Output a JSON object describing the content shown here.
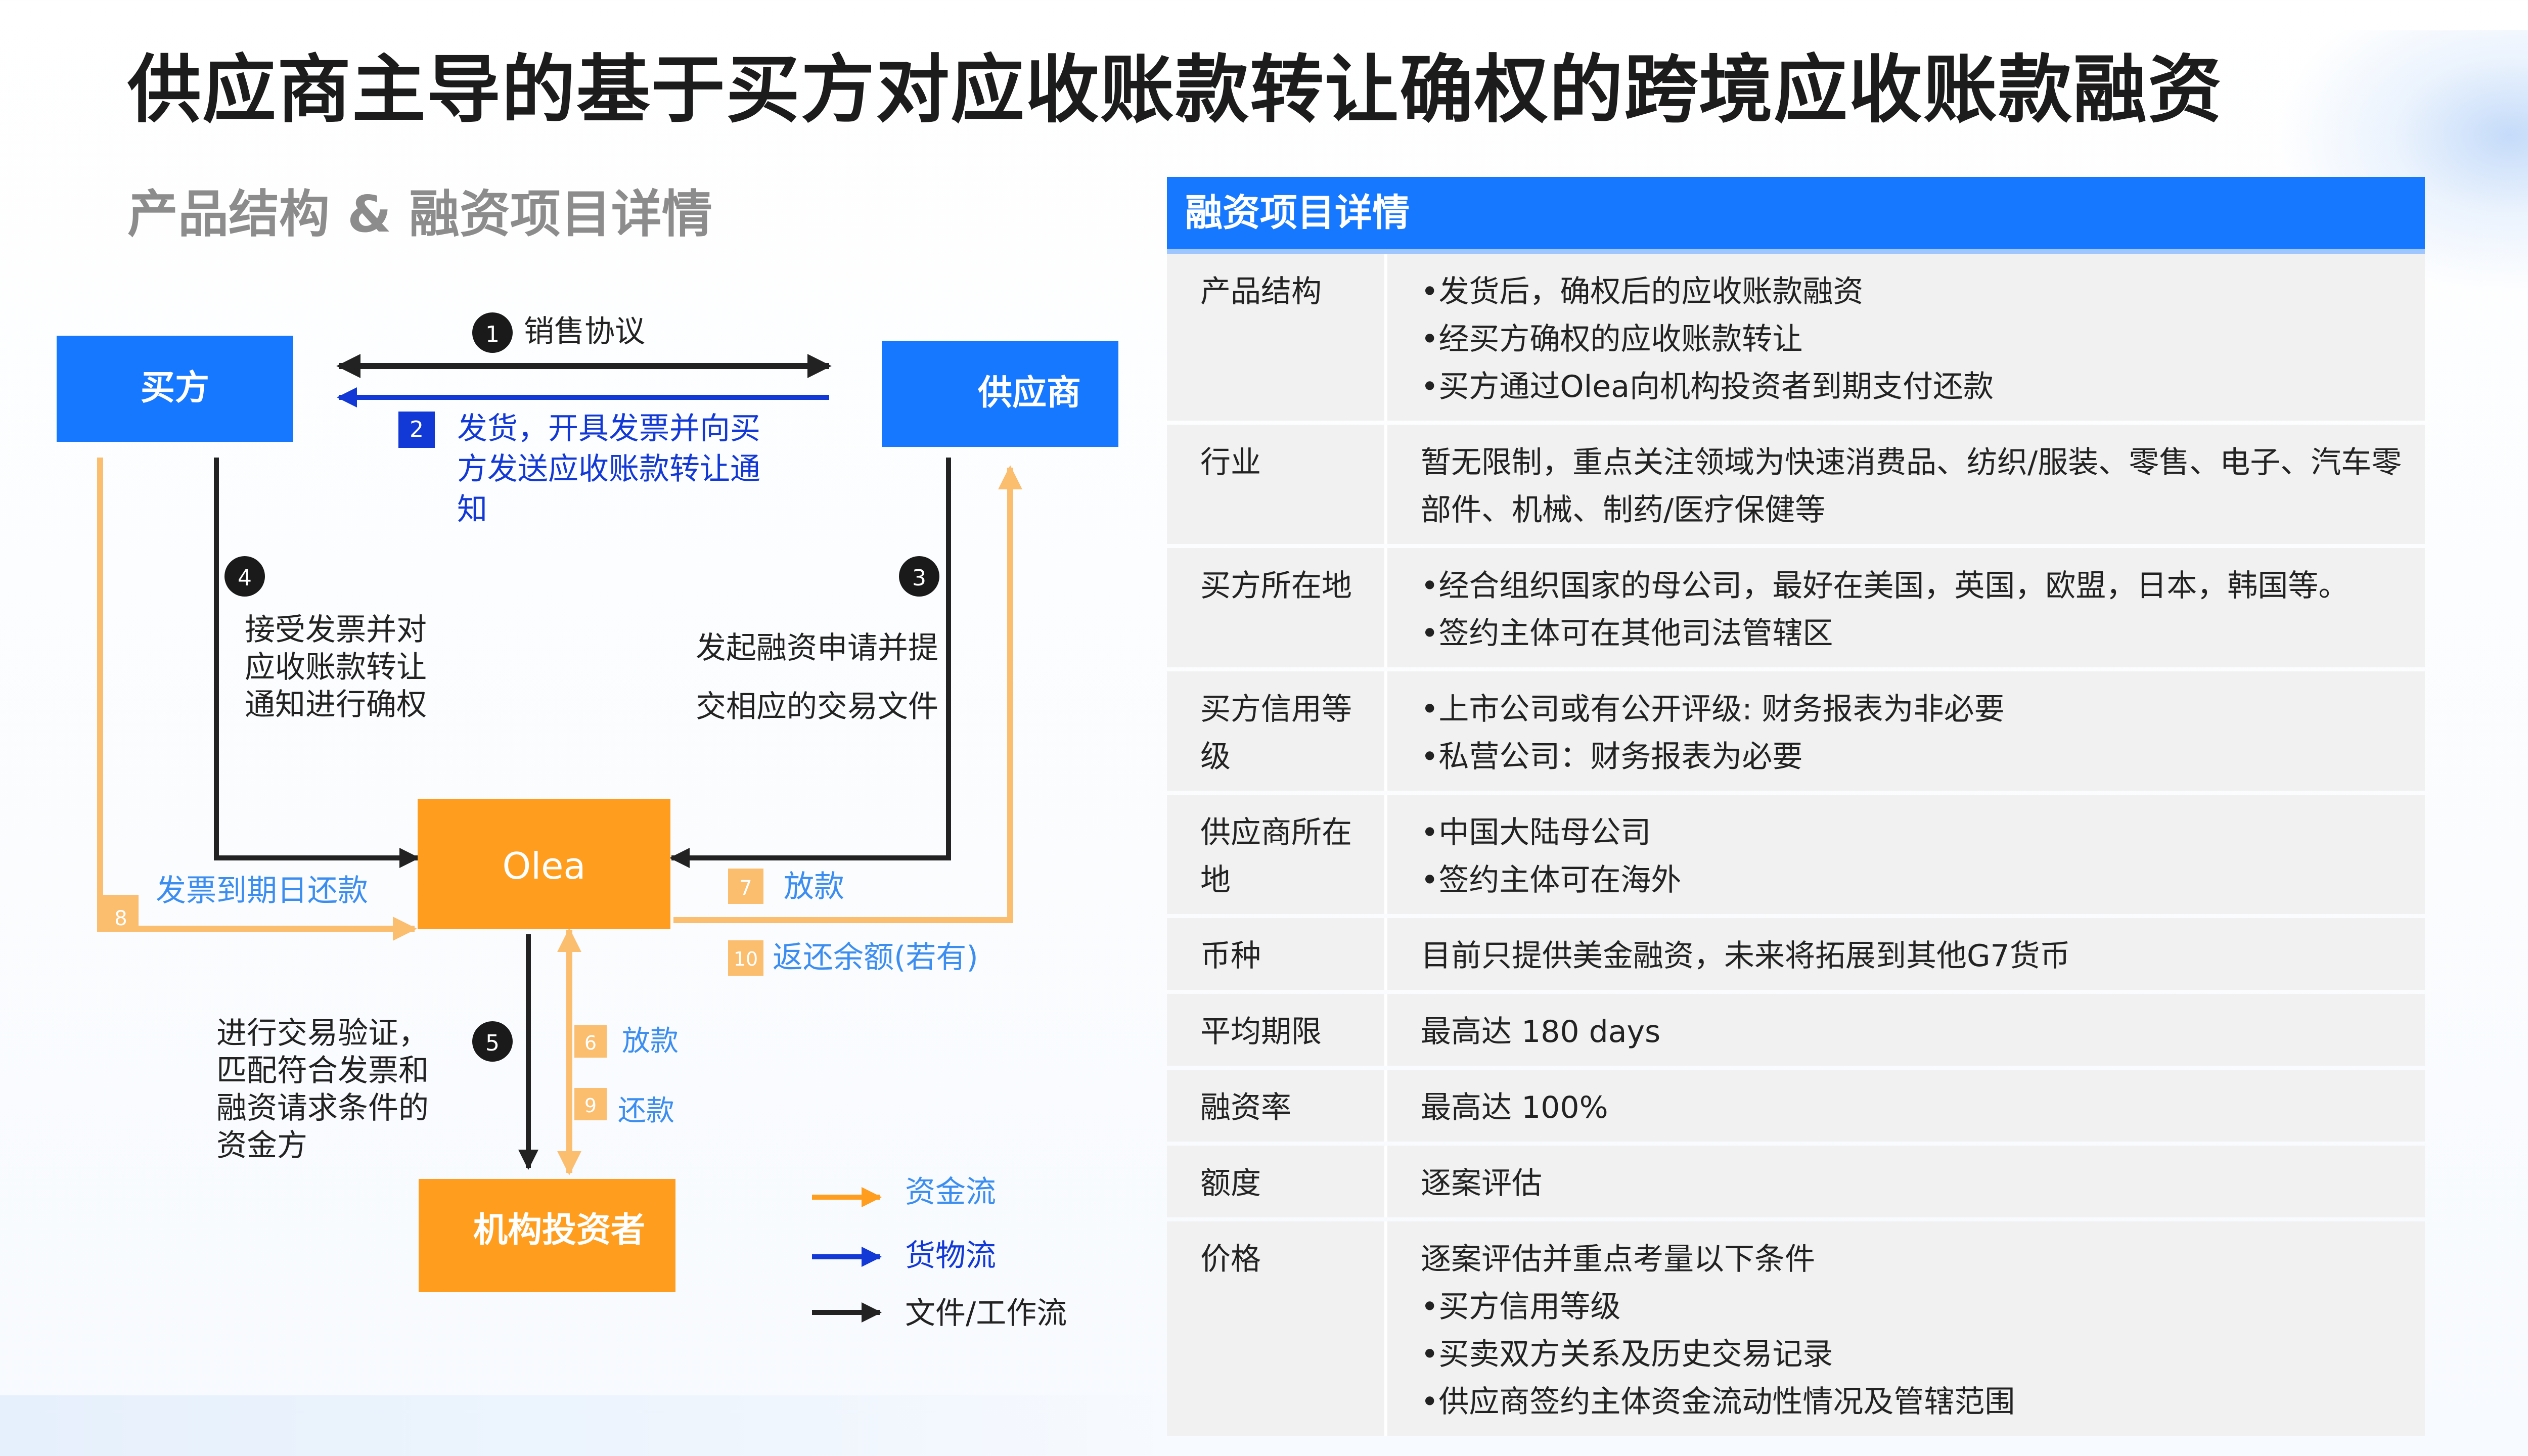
{
  "title": "供应商主导的基于买方对应收账款转让确权的跨境应收账款融资",
  "subtitle": "产品结构 & 融资项目详情",
  "colors": {
    "blue": "#1677ff",
    "orange": "#ff9d1f",
    "light_orange": "#fbbd6e",
    "dark_blue": "#1238d6",
    "text_blue": "#3c8df0",
    "black": "#222222"
  },
  "diagram": {
    "nodes": {
      "buyer": "买方",
      "supplier": "供应商",
      "olea": "Olea",
      "investor": "机构投资者"
    },
    "steps": [
      {
        "num": "1",
        "label": "销售协议"
      },
      {
        "num": "2",
        "label_lines": [
          "发货，开具发票并向买",
          "方发送应收账款转让通",
          "知"
        ]
      },
      {
        "num": "3",
        "label_lines": [
          "发起融资申请并提",
          "交相应的交易文件"
        ]
      },
      {
        "num": "4",
        "label_lines": [
          "接受发票并对",
          "应收账款转让",
          "通知进行确权"
        ]
      },
      {
        "num": "5",
        "label_lines": [
          "进行交易验证，",
          "匹配符合发票和",
          "融资请求条件的",
          "资金方"
        ]
      },
      {
        "num": "6",
        "label": "放款"
      },
      {
        "num": "7",
        "label": "放款"
      },
      {
        "num": "8",
        "label": "发票到期日还款"
      },
      {
        "num": "9",
        "label": "还款"
      },
      {
        "num": "10",
        "label": "返还余额(若有)"
      }
    ],
    "legend": [
      {
        "label": "资金流",
        "color": "#ff9d1f"
      },
      {
        "label": "货物流",
        "color": "#1238d6"
      },
      {
        "label": "文件/工作流",
        "color": "#222222"
      }
    ]
  },
  "details": {
    "header": "融资项目详情",
    "rows": [
      {
        "label": "产品结构",
        "values": [
          "•发货后，确权后的应收账款融资",
          "•经买方确权的应收账款转让",
          "•买方通过Olea向机构投资者到期支付还款"
        ]
      },
      {
        "label": "行业",
        "values": [
          "暂无限制，重点关注领域为快速消费品、纺织/服装、零售、电子、汽车零部件、机械、制药/医疗保健等"
        ]
      },
      {
        "label": "买方所在地",
        "values": [
          "•经合组织国家的母公司，最好在美国，英国，欧盟，日本，韩国等。",
          "•签约主体可在其他司法管辖区"
        ]
      },
      {
        "label": "买方信用等级",
        "values": [
          "•上市公司或有公开评级: 财务报表为非必要",
          "•私营公司：财务报表为必要"
        ]
      },
      {
        "label": "供应商所在地",
        "values": [
          "•中国大陆母公司",
          "•签约主体可在海外"
        ]
      },
      {
        "label": "币种",
        "values": [
          "目前只提供美金融资，未来将拓展到其他G7货币"
        ]
      },
      {
        "label": "平均期限",
        "values": [
          "最高达 180 days"
        ]
      },
      {
        "label": "融资率",
        "values": [
          "最高达 100%"
        ]
      },
      {
        "label": "额度",
        "values": [
          "逐案评估"
        ]
      },
      {
        "label": "价格",
        "values": [
          "逐案评估并重点考量以下条件",
          "•买方信用等级",
          "•买卖双方关系及历史交易记录",
          "•供应商签约主体资金流动性情况及管辖范围"
        ]
      }
    ]
  }
}
